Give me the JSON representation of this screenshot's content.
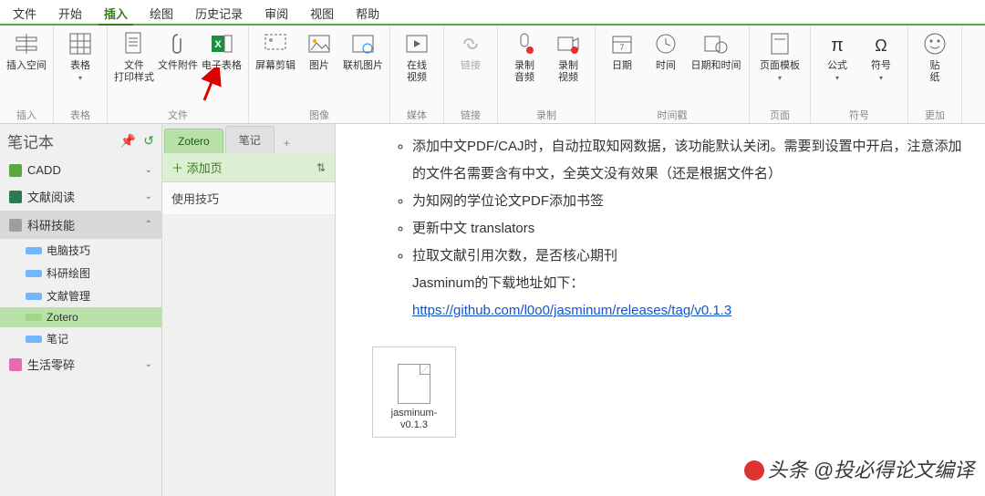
{
  "menubar": {
    "items": [
      "文件",
      "开始",
      "插入",
      "绘图",
      "历史记录",
      "审阅",
      "视图",
      "帮助"
    ],
    "active_index": 2
  },
  "ribbon": {
    "groups": [
      {
        "label": "插入",
        "buttons": [
          {
            "name": "insert-space",
            "label": "插入空间"
          }
        ]
      },
      {
        "label": "表格",
        "buttons": [
          {
            "name": "table",
            "label": "表格",
            "dropdown": true
          }
        ]
      },
      {
        "label": "文件",
        "buttons": [
          {
            "name": "file-print-style",
            "label": "文件\n打印样式"
          },
          {
            "name": "file-attachment",
            "label": "文件附件"
          },
          {
            "name": "spreadsheet",
            "label": "电子表格"
          }
        ]
      },
      {
        "label": "图像",
        "buttons": [
          {
            "name": "screen-clip",
            "label": "屏幕剪辑"
          },
          {
            "name": "picture",
            "label": "图片"
          },
          {
            "name": "online-picture",
            "label": "联机图片"
          }
        ]
      },
      {
        "label": "媒体",
        "buttons": [
          {
            "name": "online-video",
            "label": "在线\n视频"
          }
        ]
      },
      {
        "label": "链接",
        "buttons": [
          {
            "name": "link",
            "label": "链接",
            "disabled": true
          }
        ]
      },
      {
        "label": "录制",
        "buttons": [
          {
            "name": "record-audio",
            "label": "录制\n音频"
          },
          {
            "name": "record-video",
            "label": "录制\n视频"
          }
        ]
      },
      {
        "label": "时间戳",
        "buttons": [
          {
            "name": "date",
            "label": "日期"
          },
          {
            "name": "time",
            "label": "时间"
          },
          {
            "name": "datetime",
            "label": "日期和时间"
          }
        ]
      },
      {
        "label": "页面",
        "buttons": [
          {
            "name": "page-template",
            "label": "页面模板",
            "dropdown": true
          }
        ]
      },
      {
        "label": "符号",
        "buttons": [
          {
            "name": "formula",
            "label": "公式",
            "dropdown": true
          },
          {
            "name": "symbols",
            "label": "符号",
            "dropdown": true
          }
        ]
      },
      {
        "label": "更加",
        "buttons": [
          {
            "name": "sticker",
            "label": "贴\n纸"
          }
        ]
      }
    ]
  },
  "sidebar": {
    "title": "笔记本",
    "pin_icon": "pin-icon",
    "sync_icon": "sync-icon",
    "notebooks": [
      {
        "name": "CADD",
        "color": "#5aa83e",
        "expanded": false
      },
      {
        "name": "文献阅读",
        "color": "#2c7a4f",
        "expanded": false
      },
      {
        "name": "科研技能",
        "color": "#9e9e9e",
        "expanded": true,
        "selected": true,
        "children": [
          {
            "name": "电脑技巧",
            "color": "#6fb8ff"
          },
          {
            "name": "科研绘图",
            "color": "#6fb8ff"
          },
          {
            "name": "文献管理",
            "color": "#6fb8ff"
          },
          {
            "name": "Zotero",
            "color": "#9fd68a",
            "selected": true
          },
          {
            "name": "笔记",
            "color": "#6fb8ff"
          }
        ]
      },
      {
        "name": "生活零碎",
        "color": "#e86bb0",
        "expanded": false
      }
    ]
  },
  "pagelist": {
    "tabs": [
      {
        "label": "Zotero",
        "active": true
      },
      {
        "label": "笔记"
      }
    ],
    "add_label": "添加页",
    "sort_icon": "sort-icon",
    "pages": [
      {
        "title": "使用技巧"
      }
    ]
  },
  "content": {
    "bullets": [
      "添加中文PDF/CAJ时，自动拉取知网数据，该功能默认关闭。需要到设置中开启，注意添加的文件名需要含有中文，全英文没有效果（还是根据文件名）",
      "为知网的学位论文PDF添加书签",
      "更新中文 translators",
      "拉取文献引用次数，是否核心期刊"
    ],
    "download_label": "Jasminum的下载地址如下：",
    "link_text": "https://github.com/l0o0/jasminum/releases/tag/v0.1.3",
    "attachment_name": "jasminum-v0.1.3"
  },
  "watermark": {
    "text": "头条 @投必得论文编译"
  }
}
